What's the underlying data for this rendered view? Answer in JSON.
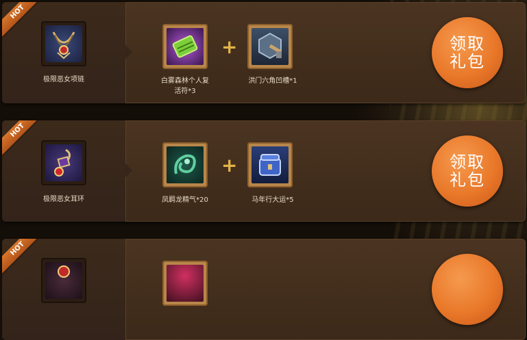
{
  "rows": [
    {
      "badge": "HOT",
      "main_item": {
        "name": "极限恶女项链",
        "icon": "necklace-icon"
      },
      "gifts": [
        {
          "name_line1": "白雾森林个人复",
          "name_line2": "活符*3",
          "icon": "scroll-icon"
        },
        {
          "name_line1": "洪门六角凹槽*1",
          "name_line2": "",
          "icon": "socket-hammer-icon"
        }
      ],
      "plus": "+",
      "button": {
        "line1": "领取",
        "line2": "礼包"
      }
    },
    {
      "badge": "HOT",
      "main_item": {
        "name": "极限恶女耳环",
        "icon": "earring-icon"
      },
      "gifts": [
        {
          "name_line1": "凤羁龙精气*20",
          "name_line2": "",
          "icon": "dragon-essence-icon"
        },
        {
          "name_line1": "马年行大运*5",
          "name_line2": "",
          "icon": "chest-icon"
        }
      ],
      "plus": "+",
      "button": {
        "line1": "领取",
        "line2": "礼包"
      }
    },
    {
      "badge": "HOT",
      "main_item": {
        "name": "",
        "icon": "ring-icon"
      },
      "gifts": [
        {
          "name_line1": "",
          "name_line2": "",
          "icon": "gift-icon"
        }
      ],
      "plus": "",
      "button": {
        "line1": "",
        "line2": ""
      }
    }
  ],
  "colors": {
    "accent": "#e9782a",
    "plus": "#e3b447",
    "badge": "#c9621f"
  }
}
